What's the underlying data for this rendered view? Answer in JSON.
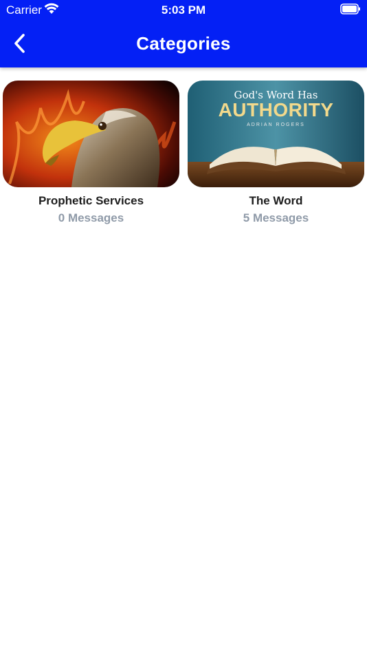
{
  "status_bar": {
    "carrier": "Carrier",
    "time": "5:03 PM"
  },
  "header": {
    "title": "Categories",
    "back_icon": "chevron-left-icon",
    "bg_color": "#0420f5"
  },
  "categories": [
    {
      "title": "Prophetic Services",
      "count": "0 Messages",
      "image": "eagle-fire-image"
    },
    {
      "title": "The Word",
      "count": "5 Messages",
      "image": "open-bible-image",
      "image_text": {
        "line1": "God's Word Has",
        "line2": "AUTHORITY",
        "line3": "ADRIAN ROGERS"
      }
    }
  ],
  "colors": {
    "count_text": "#8f9aa8",
    "title_text": "#1d1d1d"
  }
}
